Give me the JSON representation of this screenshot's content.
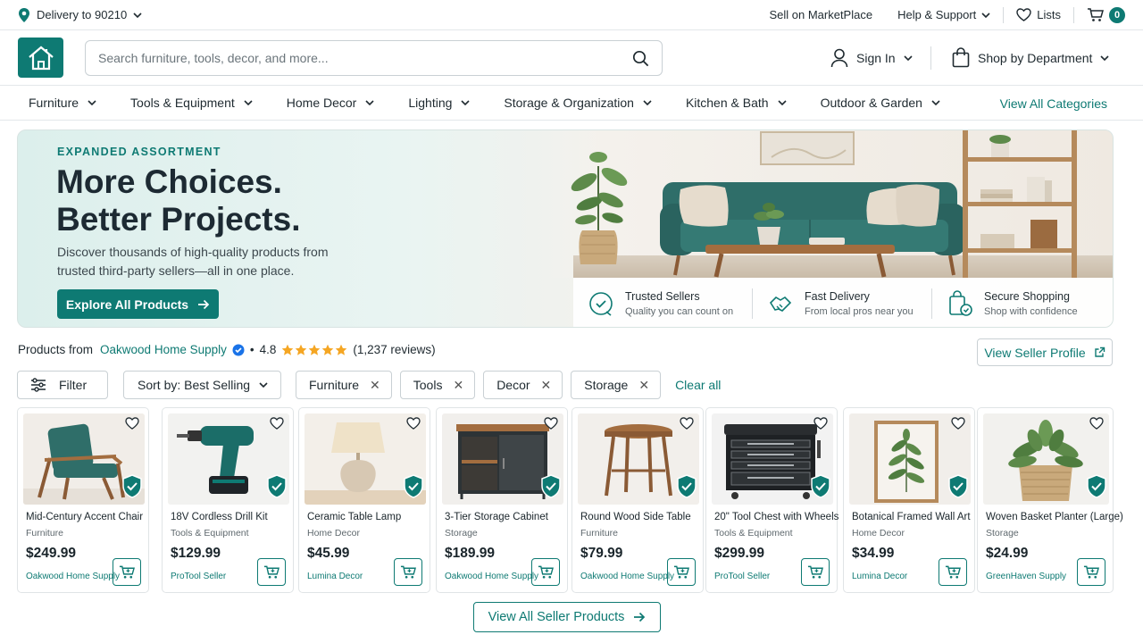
{
  "topbar": {
    "delivery": "Delivery to 90210",
    "sell": "Sell on MarketPlace",
    "help": "Help & Support",
    "lists": "Lists",
    "cart_count": "0"
  },
  "header": {
    "search_placeholder": "Search furniture, tools, decor, and more...",
    "sign_in": "Sign In",
    "shop_by_department": "Shop by Department"
  },
  "categories": {
    "items": [
      {
        "label": "Furniture"
      },
      {
        "label": "Tools & Equipment"
      },
      {
        "label": "Home Decor"
      },
      {
        "label": "Lighting"
      },
      {
        "label": "Storage & Organization"
      },
      {
        "label": "Kitchen & Bath"
      },
      {
        "label": "Outdoor & Garden"
      }
    ],
    "view_all": "View All Categories"
  },
  "hero": {
    "eyebrow": "EXPANDED ASSORTMENT",
    "headline_1": "More Choices.",
    "headline_2": "Better Projects.",
    "subtext": "Discover thousands of high-quality products from trusted third-party sellers—all in one place.",
    "cta": "Explore All Products",
    "features": [
      {
        "title": "Trusted Sellers",
        "sub": "Quality you can count on"
      },
      {
        "title": "Fast Delivery",
        "sub": "From local pros near you"
      },
      {
        "title": "Secure Shopping",
        "sub": "Shop with confidence"
      }
    ]
  },
  "seller": {
    "prefix": "Products from",
    "name": "Oakwood Home Supply",
    "bullet": "•",
    "rating": "4.8",
    "stars": 5,
    "reviews": "(1,237 reviews)",
    "view_profile": "View Seller Profile"
  },
  "filters": {
    "filter_label": "Filter",
    "sort_label": "Sort by: Best Selling",
    "chips": [
      {
        "label": "Furniture"
      },
      {
        "label": "Tools"
      },
      {
        "label": "Decor"
      },
      {
        "label": "Storage"
      }
    ],
    "clear_all": "Clear all"
  },
  "products": [
    {
      "name": "Mid-Century Accent Chair",
      "category": "Furniture",
      "price": "$249.99",
      "seller": "Oakwood Home Supply"
    },
    {
      "name": "18V Cordless Drill Kit",
      "category": "Tools & Equipment",
      "price": "$129.99",
      "seller": "ProTool Seller"
    },
    {
      "name": "Ceramic Table Lamp",
      "category": "Home Decor",
      "price": "$45.99",
      "seller": "Lumina Decor"
    },
    {
      "name": "3-Tier Storage Cabinet",
      "category": "Storage",
      "price": "$189.99",
      "seller": "Oakwood Home Supply"
    },
    {
      "name": "Round Wood Side Table",
      "category": "Furniture",
      "price": "$79.99",
      "seller": "Oakwood Home Supply"
    },
    {
      "name": "20\" Tool Chest with Wheels",
      "category": "Tools & Equipment",
      "price": "$299.99",
      "seller": "ProTool Seller"
    },
    {
      "name": "Botanical Framed Wall Art",
      "category": "Home Decor",
      "price": "$34.99",
      "seller": "Lumina Decor"
    },
    {
      "name": "Woven Basket Planter (Large)",
      "category": "Storage",
      "price": "$24.99",
      "seller": "GreenHaven Supply"
    }
  ],
  "view_all_products": "View All Seller Products",
  "colors": {
    "accent": "#0e7a73",
    "star": "#f5a623",
    "verified": "#1a73e8"
  }
}
